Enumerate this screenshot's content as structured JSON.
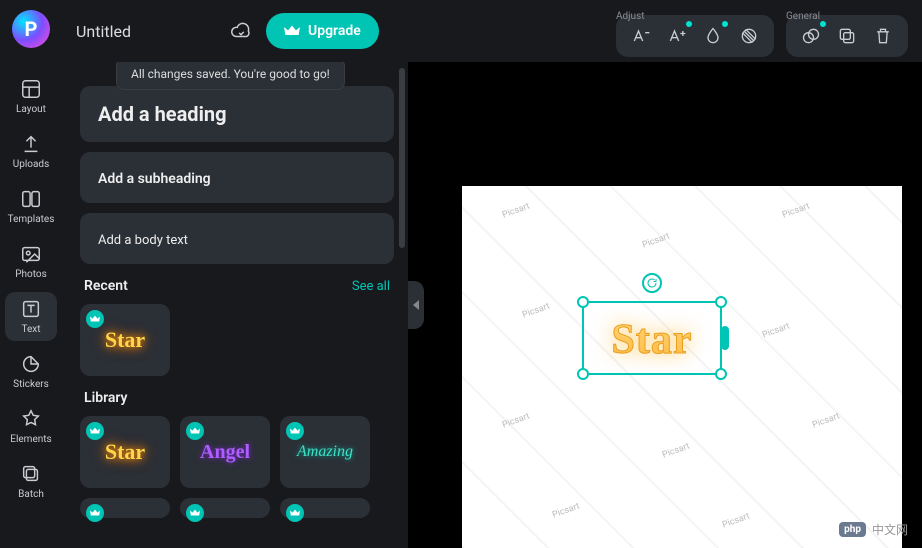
{
  "document": {
    "title": "Untitled"
  },
  "tooltip": {
    "saved": "All changes saved. You're good to go!"
  },
  "header": {
    "upgrade_label": "Upgrade",
    "group_adjust": "Adjust",
    "group_general": "General"
  },
  "nav": {
    "layout": "Layout",
    "uploads": "Uploads",
    "templates": "Templates",
    "photos": "Photos",
    "text": "Text",
    "stickers": "Stickers",
    "elements": "Elements",
    "batch": "Batch"
  },
  "panel": {
    "add_heading": "Add a heading",
    "add_subheading": "Add a subheading",
    "add_body": "Add a body text",
    "recent": "Recent",
    "library": "Library",
    "see_all": "See all"
  },
  "thumbs": {
    "star": "Star",
    "angel": "Angel",
    "amazing": "Amazing"
  },
  "canvas": {
    "selected_text": "Star"
  },
  "watermark": {
    "brand": "中文网",
    "php": "php"
  }
}
